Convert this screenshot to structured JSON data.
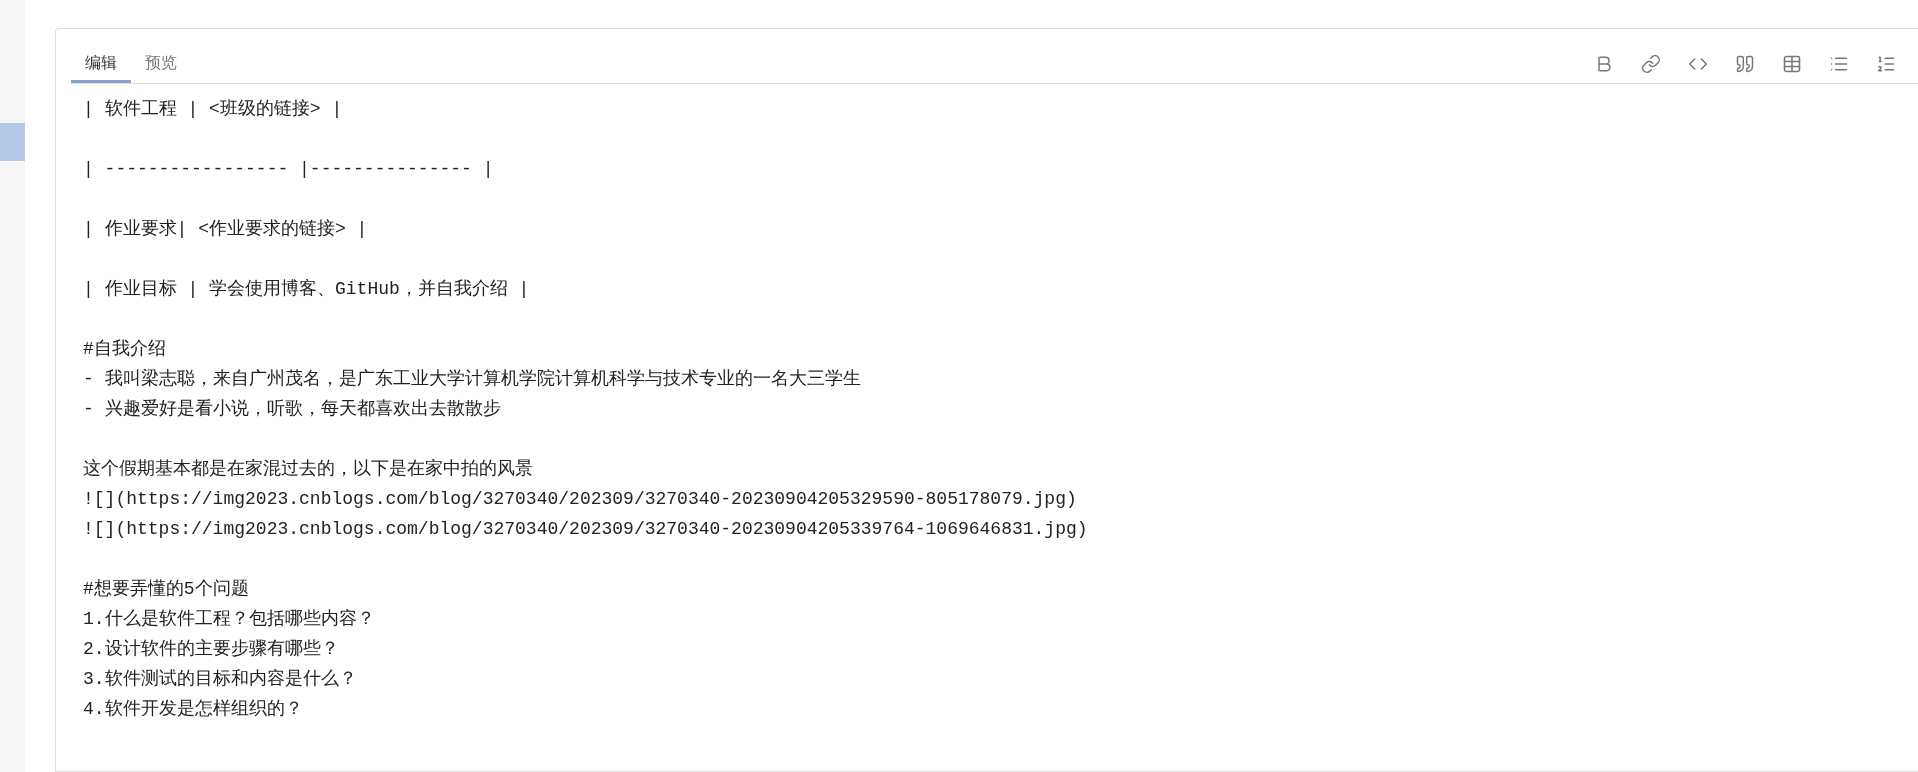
{
  "editor": {
    "tabs": [
      {
        "label": "编辑",
        "selected": true
      },
      {
        "label": "预览",
        "selected": false
      }
    ],
    "toolbar": [
      {
        "kind": "bold"
      },
      {
        "kind": "link"
      },
      {
        "kind": "code"
      },
      {
        "kind": "quote"
      },
      {
        "kind": "table"
      },
      {
        "kind": "bullet-list"
      },
      {
        "kind": "numbered-list"
      }
    ],
    "lines": [
      {
        "kind": "text",
        "text": "| 软件工程 | <班级的链接> |"
      },
      {
        "kind": "blank"
      },
      {
        "kind": "text",
        "text": "| ----------------- |--------------- |"
      },
      {
        "kind": "blank"
      },
      {
        "kind": "text",
        "text": "| 作业要求| <作业要求的链接> |"
      },
      {
        "kind": "blank"
      },
      {
        "kind": "text",
        "text": "| 作业目标 | 学会使用博客、GitHub，并自我介绍 |"
      },
      {
        "kind": "blank"
      },
      {
        "kind": "text",
        "text": "#自我介绍"
      },
      {
        "kind": "text",
        "text": "- 我叫梁志聪，来自广州茂名，是广东工业大学计算机学院计算机科学与技术专业的一名大三学生"
      },
      {
        "kind": "text",
        "text": "- 兴趣爱好是看小说，听歌，每天都喜欢出去散散步"
      },
      {
        "kind": "blank"
      },
      {
        "kind": "text",
        "text": "这个假期基本都是在家混过去的，以下是在家中拍的风景"
      },
      {
        "kind": "text",
        "text": "![](https://img2023.cnblogs.com/blog/3270340/202309/3270340-20230904205329590-805178079.jpg)"
      },
      {
        "kind": "text",
        "text": "![](https://img2023.cnblogs.com/blog/3270340/202309/3270340-20230904205339764-1069646831.jpg)"
      },
      {
        "kind": "blank"
      },
      {
        "kind": "text",
        "text": "#想要弄懂的5个问题"
      },
      {
        "kind": "text",
        "text": "1.什么是软件工程？包括哪些内容？"
      },
      {
        "kind": "text",
        "text": "2.设计软件的主要步骤有哪些？"
      },
      {
        "kind": "text",
        "text": "3.软件测试的目标和内容是什么？"
      },
      {
        "kind": "text",
        "text": "4.软件开发是怎样组织的？"
      }
    ]
  }
}
